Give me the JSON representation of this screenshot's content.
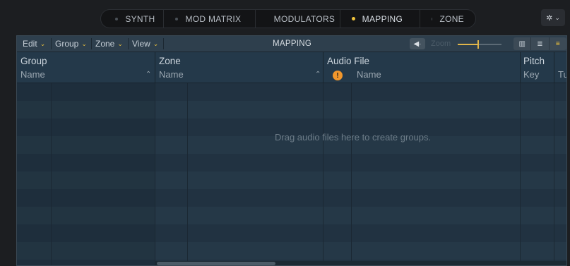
{
  "tabs": [
    {
      "label": "SYNTH",
      "active": false
    },
    {
      "label": "MOD MATRIX",
      "active": false
    },
    {
      "label": "MODULATORS",
      "active": false
    },
    {
      "label": "MAPPING",
      "active": true
    },
    {
      "label": "ZONE",
      "active": false
    }
  ],
  "settings": {
    "icon": "gear-icon",
    "chevron": "chevron-down-icon"
  },
  "toolbar": {
    "menus": [
      {
        "label": "Edit"
      },
      {
        "label": "Group"
      },
      {
        "label": "Zone"
      },
      {
        "label": "View"
      }
    ],
    "title": "MAPPING",
    "zoom_label": "Zoom",
    "speaker_icon": "speaker-icon",
    "view_icons": [
      "keyboard-icon",
      "group-list-icon",
      "zone-list-icon"
    ]
  },
  "columns": {
    "group": {
      "title": "Group",
      "sub": "Name"
    },
    "zone": {
      "title": "Zone",
      "sub": "Name"
    },
    "audio_file": {
      "title": "Audio File",
      "sub": "Name",
      "warning": "!"
    },
    "pitch": {
      "title": "Pitch",
      "sub": "Key",
      "sub2": "Tu"
    }
  },
  "empty_message": "Drag audio files here to create groups.",
  "colors": {
    "accent": "#f0c43c",
    "warning": "#f0962c",
    "panel_bg": "#233543"
  }
}
